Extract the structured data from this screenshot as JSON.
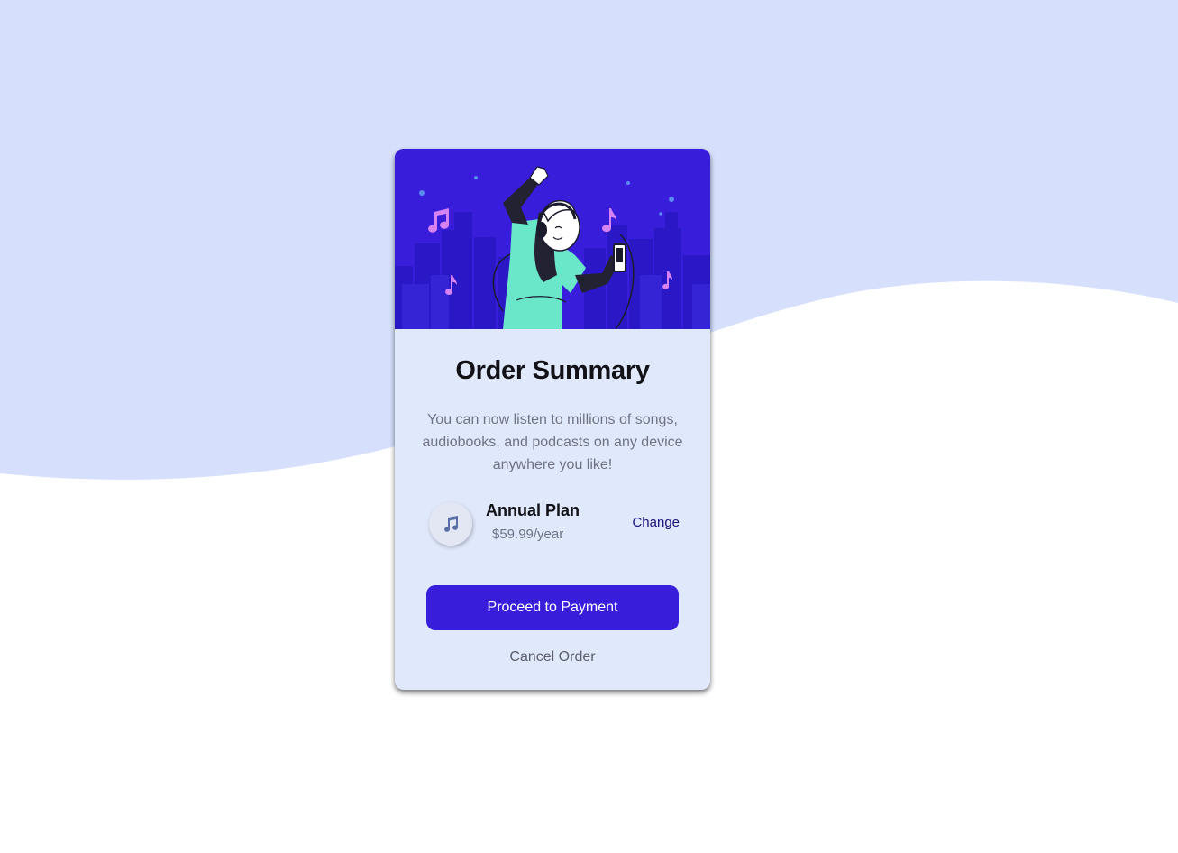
{
  "colors": {
    "page_wave": "#d6e0fc",
    "page_background": "#ffffff",
    "card_background": "#e0e8fc",
    "hero_background": "#381ddb",
    "primary_button": "#381ddb",
    "title_text": "#111116",
    "body_text": "#707384",
    "link_text": "#1a1176"
  },
  "card": {
    "hero_image": "woman-listening-to-music-illustration",
    "title": "Order Summary",
    "description": "You can now listen to millions of songs, audiobooks, and podcasts on any device anywhere you like!",
    "plan": {
      "icon": "music-note-icon",
      "name": "Annual Plan",
      "price": "$59.99/year",
      "change_label": "Change"
    },
    "proceed_label": "Proceed to Payment",
    "cancel_label": "Cancel Order"
  }
}
